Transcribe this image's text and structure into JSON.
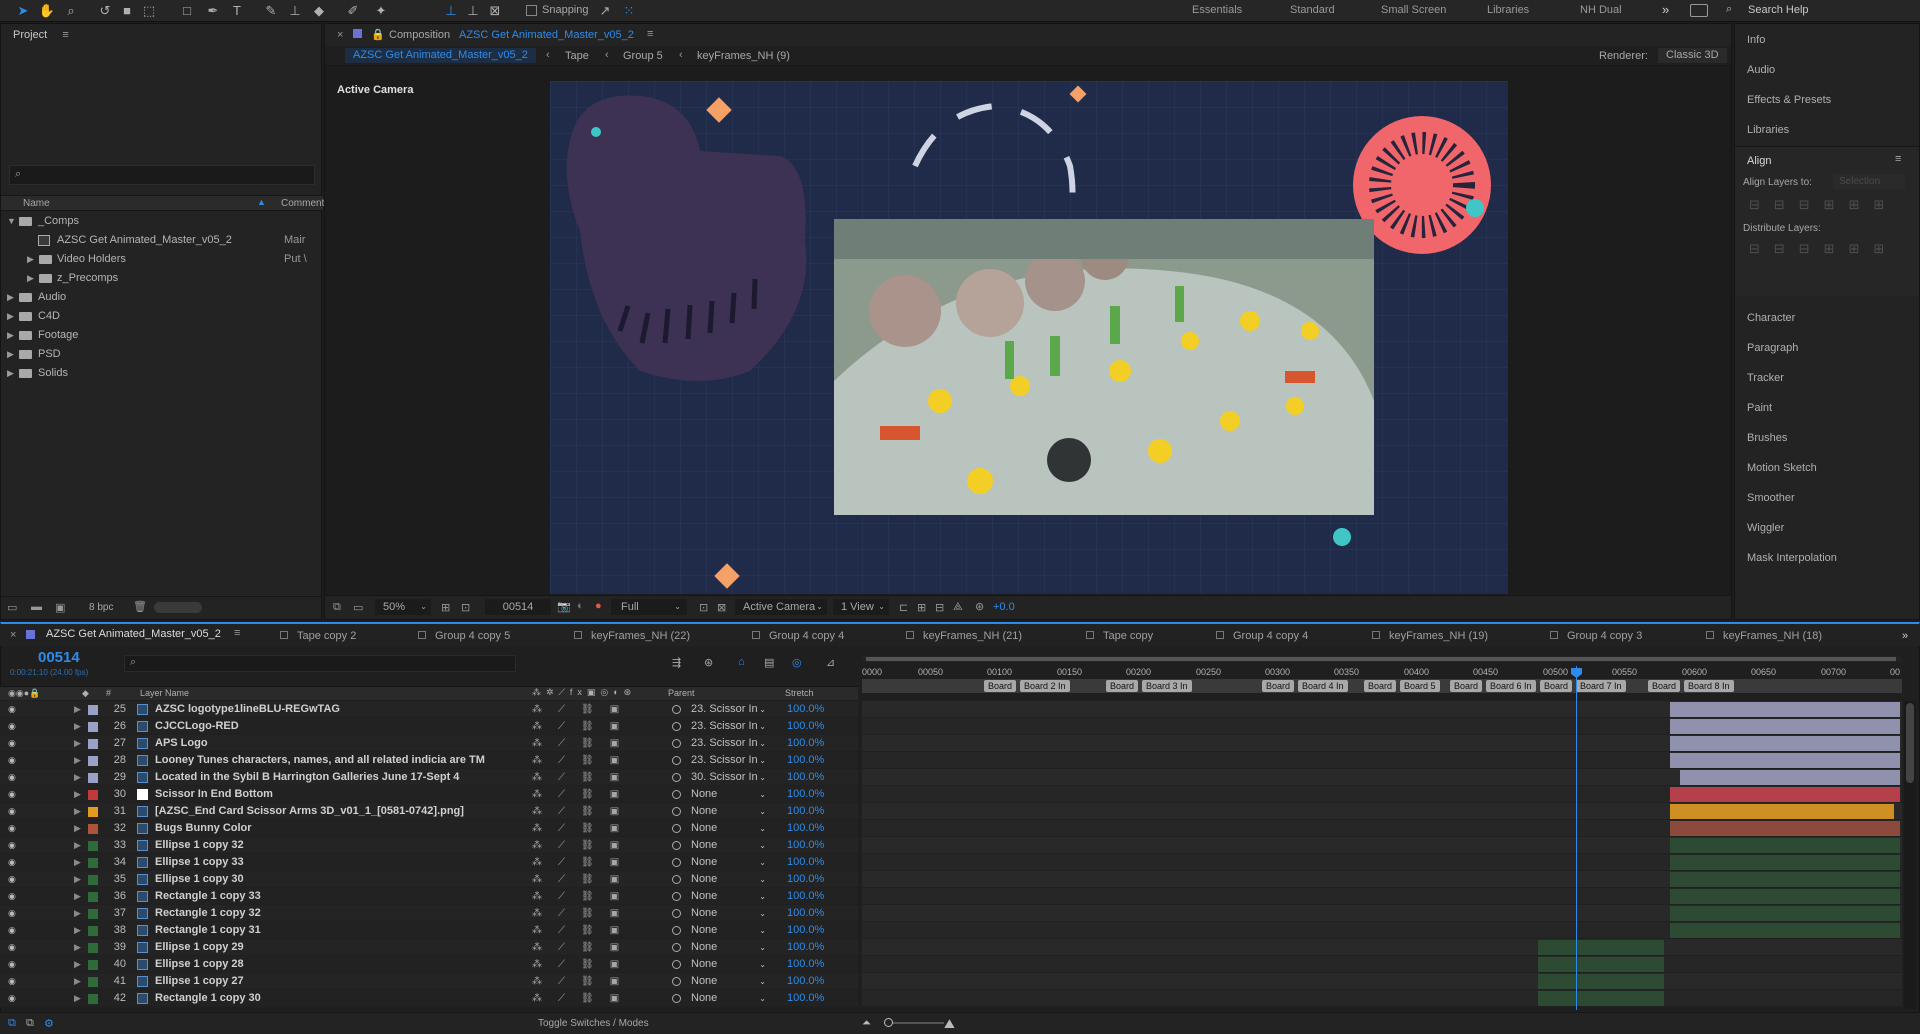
{
  "toolbar": {
    "snapping_label": "Snapping",
    "workspaces": [
      "Essentials",
      "Standard",
      "Small Screen",
      "Libraries",
      "NH Dual"
    ],
    "search_placeholder": "Search Help"
  },
  "project": {
    "title": "Project",
    "col_name": "Name",
    "col_comment": "Comment",
    "tree": [
      {
        "label": "_Comps",
        "level": 0,
        "open": true,
        "type": "folder",
        "comment": ""
      },
      {
        "label": "AZSC Get Animated_Master_v05_2",
        "level": 1,
        "type": "comp",
        "comment": "Mair"
      },
      {
        "label": "Video Holders",
        "level": 1,
        "type": "folder",
        "comment": "Put \\"
      },
      {
        "label": "z_Precomps",
        "level": 1,
        "type": "folder",
        "comment": ""
      },
      {
        "label": "Audio",
        "level": 0,
        "type": "folder",
        "comment": ""
      },
      {
        "label": "C4D",
        "level": 0,
        "type": "folder",
        "comment": ""
      },
      {
        "label": "Footage",
        "level": 0,
        "type": "folder",
        "comment": ""
      },
      {
        "label": "PSD",
        "level": 0,
        "type": "folder",
        "comment": ""
      },
      {
        "label": "Solids",
        "level": 0,
        "type": "folder",
        "comment": ""
      }
    ],
    "bpc": "8 bpc"
  },
  "comp_viewer": {
    "header_prefix": "Composition",
    "comp_name": "AZSC Get Animated_Master_v05_2",
    "breadcrumbs": [
      "AZSC Get Animated_Master_v05_2",
      "Tape",
      "Group 5",
      "keyFrames_NH (9)"
    ],
    "renderer_label": "Renderer:",
    "renderer_value": "Classic 3D",
    "camera_label": "Active Camera",
    "zoom": "50%",
    "timecode": "00514",
    "resolution": "Full",
    "view_camera": "Active Camera",
    "views": "1 View",
    "exposure": "+0.0"
  },
  "right_panel": {
    "items_top": [
      "Info",
      "Audio",
      "Effects & Presets",
      "Libraries"
    ],
    "align_title": "Align",
    "align_layers_to": "Align Layers to:",
    "align_selection": "Selection",
    "distribute_layers": "Distribute Layers:",
    "items_bottom": [
      "Character",
      "Paragraph",
      "Tracker",
      "Paint",
      "Brushes",
      "Motion Sketch",
      "Smoother",
      "Wiggler",
      "Mask Interpolation"
    ]
  },
  "timeline": {
    "tabs": [
      "AZSC Get Animated_Master_v05_2",
      "Tape copy 2",
      "Group 4 copy 5",
      "keyFrames_NH (22)",
      "Group 4 copy 4",
      "keyFrames_NH (21)",
      "Tape copy",
      "Group 4 copy 4",
      "keyFrames_NH (19)",
      "Group 4 copy 3",
      "keyFrames_NH (18)"
    ],
    "current_frame": "00514",
    "timecode_sub": "0:00:21:10 (24.00 fps)",
    "col_hash": "#",
    "col_layer_name": "Layer Name",
    "col_parent": "Parent",
    "col_stretch": "Stretch",
    "ruler": [
      "0000",
      "00050",
      "00100",
      "00150",
      "00200",
      "00250",
      "00300",
      "00350",
      "00400",
      "00450",
      "00500",
      "00550",
      "00600",
      "00650",
      "00700",
      "00"
    ],
    "markers": [
      "Board",
      "Board 2 In",
      "Board",
      "Board 3 In",
      "Board",
      "Board 4 In",
      "Board",
      "Board 5",
      "Board",
      "Board 6 In",
      "Board",
      "Board 7 In",
      "Board",
      "Board 8 In"
    ],
    "toggle_label": "Toggle Switches / Modes",
    "layers": [
      {
        "num": "25",
        "name": "AZSC logotype1lineBLU-REGwTAG",
        "color": "#9aa0c8",
        "parent": "23. Scissor In",
        "stretch": "100.0%"
      },
      {
        "num": "26",
        "name": "CJCCLogo-RED",
        "color": "#9aa0c8",
        "parent": "23. Scissor In",
        "stretch": "100.0%"
      },
      {
        "num": "27",
        "name": "APS Logo",
        "color": "#9aa0c8",
        "parent": "23. Scissor In",
        "stretch": "100.0%"
      },
      {
        "num": "28",
        "name": "Looney Tunes characters, names, and all related indicia are TM",
        "color": "#9aa0c8",
        "parent": "23. Scissor In",
        "stretch": "100.0%"
      },
      {
        "num": "29",
        "name": "Located in the Sybil B Harrington Galleries June 17-Sept 4",
        "color": "#9aa0c8",
        "parent": "30. Scissor In",
        "stretch": "100.0%"
      },
      {
        "num": "30",
        "name": "Scissor In End Bottom",
        "color": "#c0393b",
        "parent": "None",
        "stretch": "100.0%"
      },
      {
        "num": "31",
        "name": "[AZSC_End Card Scissor Arms 3D_v01_1_[0581-0742].png]",
        "color": "#e39a1e",
        "parent": "None",
        "stretch": "100.0%"
      },
      {
        "num": "32",
        "name": "Bugs Bunny Color",
        "color": "#b0533c",
        "parent": "None",
        "stretch": "100.0%"
      },
      {
        "num": "33",
        "name": "Ellipse 1 copy 32",
        "color": "#2f6b3a",
        "parent": "None",
        "stretch": "100.0%"
      },
      {
        "num": "34",
        "name": "Ellipse 1 copy 33",
        "color": "#2f6b3a",
        "parent": "None",
        "stretch": "100.0%"
      },
      {
        "num": "35",
        "name": "Ellipse 1 copy 30",
        "color": "#2f6b3a",
        "parent": "None",
        "stretch": "100.0%"
      },
      {
        "num": "36",
        "name": "Rectangle 1 copy 33",
        "color": "#2f6b3a",
        "parent": "None",
        "stretch": "100.0%"
      },
      {
        "num": "37",
        "name": "Rectangle 1 copy 32",
        "color": "#2f6b3a",
        "parent": "None",
        "stretch": "100.0%"
      },
      {
        "num": "38",
        "name": "Rectangle 1 copy 31",
        "color": "#2f6b3a",
        "parent": "None",
        "stretch": "100.0%"
      },
      {
        "num": "39",
        "name": "Ellipse 1 copy 29",
        "color": "#2f6b3a",
        "parent": "None",
        "stretch": "100.0%"
      },
      {
        "num": "40",
        "name": "Ellipse 1 copy 28",
        "color": "#2f6b3a",
        "parent": "None",
        "stretch": "100.0%"
      },
      {
        "num": "41",
        "name": "Ellipse 1 copy 27",
        "color": "#2f6b3a",
        "parent": "None",
        "stretch": "100.0%"
      },
      {
        "num": "42",
        "name": "Rectangle 1 copy 30",
        "color": "#2f6b3a",
        "parent": "None",
        "stretch": "100.0%"
      }
    ]
  },
  "colors": {
    "accent": "#2d8ceb",
    "pink_disc": "#f0666b",
    "orange_diamond": "#f4a066",
    "teal_dot": "#3fc7c7",
    "canvas_bg": "#1f2b49"
  }
}
